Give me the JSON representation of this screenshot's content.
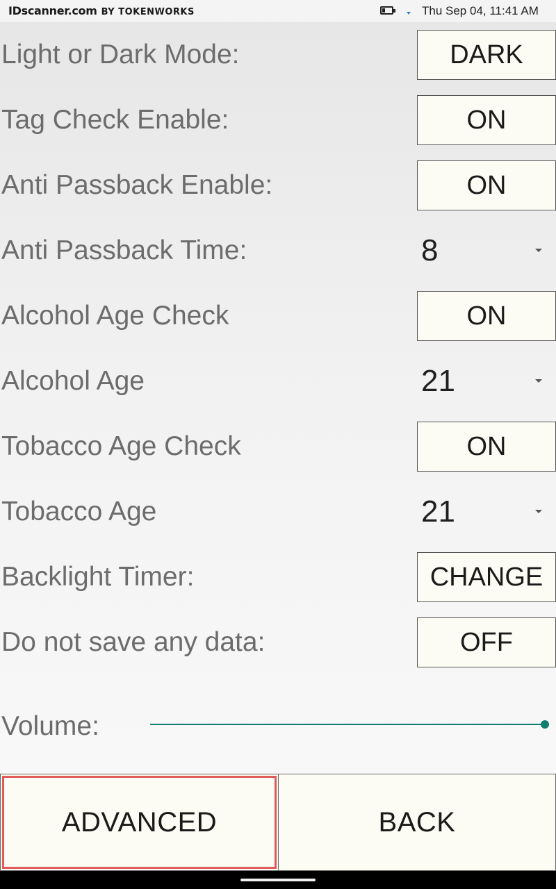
{
  "status_bar": {
    "brand": "IDscanner.com",
    "brand_by": "BY TOKENWORKS",
    "datetime": "Thu Sep 04, 11:41 AM",
    "icons": [
      "battery-icon",
      "signal-icon"
    ]
  },
  "settings": {
    "light_dark": {
      "label": "Light or Dark Mode:",
      "value": "DARK"
    },
    "tag_check": {
      "label": "Tag Check Enable:",
      "value": "ON"
    },
    "anti_passback": {
      "label": "Anti Passback Enable:",
      "value": "ON"
    },
    "anti_passback_time": {
      "label": "Anti Passback Time:",
      "value": "8"
    },
    "alcohol_check": {
      "label": "Alcohol Age Check",
      "value": "ON"
    },
    "alcohol_age": {
      "label": "Alcohol Age",
      "value": "21"
    },
    "tobacco_check": {
      "label": "Tobacco Age Check",
      "value": "ON"
    },
    "tobacco_age": {
      "label": "Tobacco Age",
      "value": "21"
    },
    "backlight": {
      "label": "Backlight Timer:",
      "value": "CHANGE"
    },
    "no_save": {
      "label": "Do not save any data:",
      "value": "OFF"
    }
  },
  "volume": {
    "label": "Volume:",
    "level_fraction": 1.0
  },
  "buttons": {
    "advanced": "ADVANCED",
    "back": "BACK"
  },
  "colors": {
    "accent": "#117d6f",
    "focus": "#e05a5a",
    "button_bg": "#fdfcf4"
  }
}
